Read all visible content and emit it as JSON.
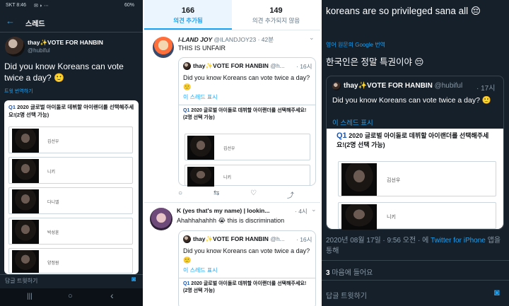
{
  "left": {
    "status": {
      "carrier": "SKT 8:46",
      "icons": "✉ ◗ ⋯",
      "battery": "60%"
    },
    "header": {
      "back": "←",
      "title": "스레드"
    },
    "tweet": {
      "name": "thay✨VOTE FOR HANBIN",
      "handle": "@hubiful",
      "text": "Did you know Koreans can vote twice a day? 🙂",
      "translate": "트윗 번역하기"
    },
    "poll": {
      "q_num": "Q1",
      "question": "2020 글로벌 아이돌로 데뷔할 아이랜더를 선택해주세요!(2명 선택 가능)",
      "options": [
        "김선우",
        "니키",
        "다니엘",
        "박성훈",
        "양정원"
      ]
    },
    "reply": {
      "placeholder": "답글 트윗하기"
    },
    "nav": {
      "recent": "|||",
      "home": "○",
      "back": "‹"
    }
  },
  "middle": {
    "stats": [
      {
        "count": "166",
        "label": "의견 추가됨"
      },
      {
        "count": "149",
        "label": "의견 추가되지 않음"
      }
    ],
    "tweets": [
      {
        "name": "I-LAND JOY",
        "handle": "@ILANDJOY23",
        "time": "· 42분",
        "text": "THIS IS UNFAIR",
        "quote": {
          "name": "thay✨VOTE FOR HANBIN",
          "handle": "@h...",
          "time": "· 16시",
          "text": "Did you know Koreans can vote twice a day? 🙂",
          "show_thread": "이 스레드 표시"
        },
        "poll": {
          "q_num": "Q1",
          "question": "2020 글로벌 아이돌로 데뷔할 아이랜더를 선택해주세요!(2명 선택 가능)",
          "options": [
            "김선우",
            "니키"
          ]
        }
      },
      {
        "name": "K (yes that's my name) | lookin...",
        "handle": "",
        "time": "· 4시",
        "text": "Ahahhahahhh 😭 this is discrimination",
        "quote": {
          "name": "thay✨VOTE FOR HANBIN",
          "handle": "@h...",
          "time": "· 16시",
          "text": "Did you know Koreans can vote twice a day? 🙂",
          "show_thread": "이 스레드 표시"
        },
        "poll": {
          "q_num": "Q1",
          "question": "2020 글로벌 아이돌로 데뷔할 아이랜더를 선택해주세요!(2명 선택 가능)"
        }
      }
    ],
    "actions": [
      "○",
      "⇆",
      "♡",
      "⤴"
    ]
  },
  "right": {
    "text": "koreans are so privileged sana all 😔",
    "translated_by": "영어 원문의 Google 번역",
    "translation": "한국인은 정말 특권이야 😔",
    "quote": {
      "name": "thay✨VOTE FOR HANBIN",
      "handle": "@hubiful",
      "time": "· 17시",
      "text": "Did you know Koreans can vote twice a day? 🙂",
      "show_thread": "이 스레드 표시"
    },
    "poll": {
      "q_num": "Q1",
      "question": "2020 글로벌 아이돌로 데뷔할 아이랜더를 선택해주세요!(2명 선택 가능)",
      "options": [
        "김선우",
        "니키"
      ]
    },
    "meta": {
      "date": "2020년 08월 17일 · 9:56 오전 · 에",
      "source": "Twitter for iPhone",
      "suffix": "앱을 통해"
    },
    "likes": {
      "count": "3",
      "label": "마음에 들어요"
    },
    "reply": {
      "placeholder": "답글 트윗하기"
    }
  }
}
